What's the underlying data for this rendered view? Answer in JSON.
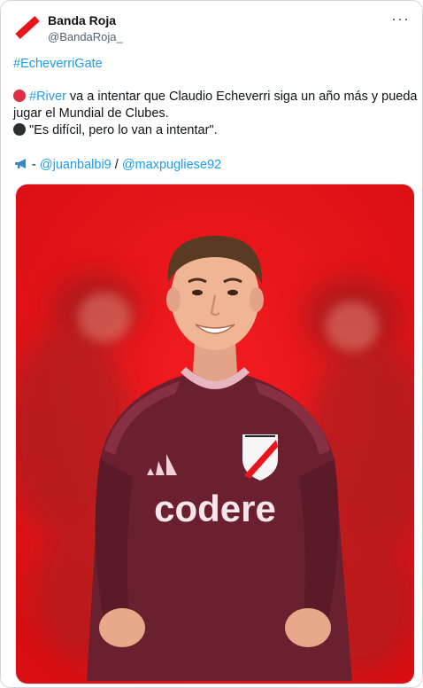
{
  "author": {
    "name": "Banda Roja",
    "handle": "@BandaRoja_"
  },
  "more_menu": "···",
  "tweet": {
    "hashtag_line": "#EcheverriGate",
    "line1_hashtag": "#River",
    "line1_rest": " va a intentar que Claudio Echeverri siga un año más y pueda",
    "line2": "jugar el Mundial de Clubes.",
    "quote": "\"Es difícil, pero lo van a intentar\".",
    "source_sep": " - ",
    "mention1": "@juanbalbi9",
    "mention_sep": " / ",
    "mention2": "@maxpugliese92"
  },
  "media": {
    "shirt_sponsor": "codere"
  },
  "colors": {
    "link": "#1d9bf0",
    "background_red": "#e8161c",
    "shirt": "#6b2030"
  }
}
